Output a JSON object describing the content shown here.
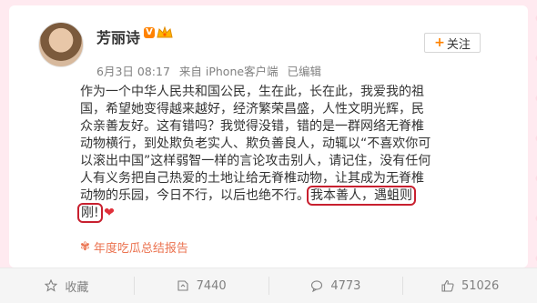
{
  "post": {
    "author": "芳丽诗",
    "vip_badge": "V",
    "follow_label": "关注",
    "follow_plus": "+",
    "timestamp": "6月3日 08:17",
    "source": "来自 iPhone客户端",
    "edited": "已编辑",
    "lines": [
      "作为一个中华人民共和国公民，生在此，长在此，我爱我的祖",
      "国，希望她变得越来越好，经济繁荣昌盛，人性文明光辉，民",
      "众亲善友好。这有错吗？我觉得没错，错的是一群网络无脊椎",
      "动物横行，到处欺负老实人、欺负善良人，动辄以“不喜欢你可",
      "以滚出中国”这样弱智一样的言论攻击别人，请记住，没有任何",
      "人有义务把自己热爱的土地让给无脊椎动物，让其成为无脊椎",
      "动物的乐园，今日不行，以后也绝不行。"
    ],
    "highlight_a": "我本善人，遇蛆则",
    "highlight_b": "刚!",
    "heart": "❤",
    "summary": "年度吃瓜总结报告",
    "summary_icon": "✾"
  },
  "actions": {
    "favorite": "收藏",
    "repost": "7440",
    "comment": "4773",
    "like": "51026"
  }
}
